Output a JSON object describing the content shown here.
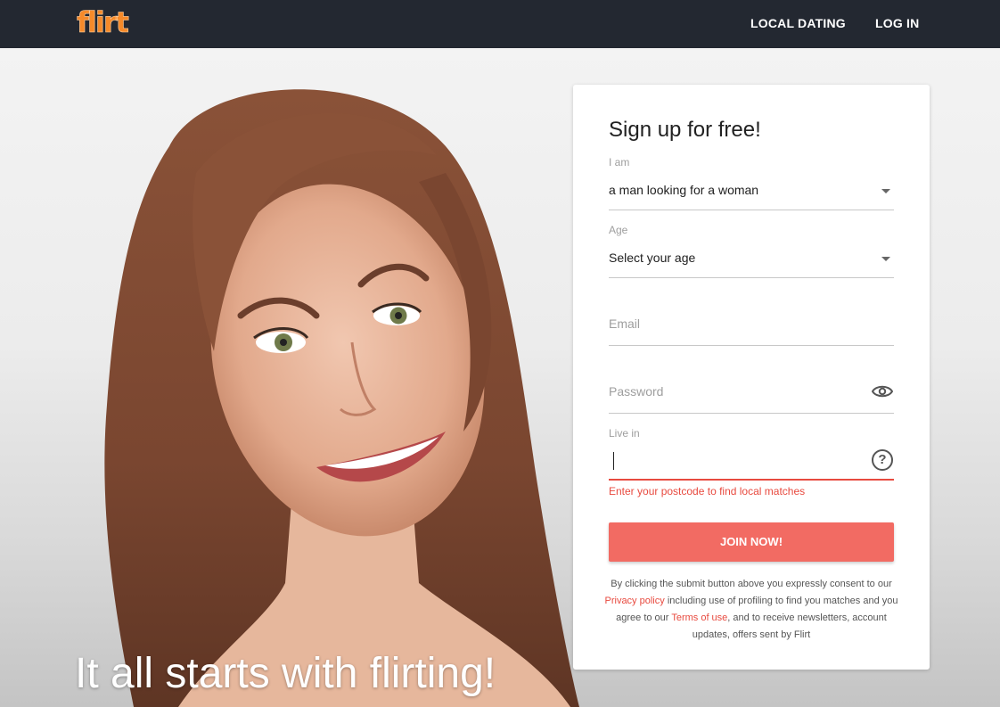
{
  "brand": {
    "logo_text": "flirt",
    "logo_color": "#f58a2a"
  },
  "nav": {
    "local_dating": "LOCAL DATING",
    "log_in": "LOG IN"
  },
  "hero": {
    "tagline": "It all starts with flirting!"
  },
  "form": {
    "title": "Sign up for free!",
    "gender": {
      "label": "I am",
      "value": "a man looking for a woman"
    },
    "age": {
      "label": "Age",
      "value": "Select your age"
    },
    "email": {
      "placeholder": "Email"
    },
    "password": {
      "placeholder": "Password"
    },
    "location": {
      "label": "Live in",
      "value": "",
      "error": "Enter your postcode to find local matches"
    },
    "join_label": "JOIN NOW!",
    "legal": {
      "part1": "By clicking the submit button above you expressly consent to our",
      "privacy_link": "Privacy policy",
      "part2": "including use of profiling to find you matches and you agree to our",
      "terms_link": "Terms of use",
      "part3": ", and to receive newsletters, account updates, offers sent by Flirt"
    }
  },
  "colors": {
    "topbar": "#232831",
    "accent": "#f26b63",
    "error": "#e84a3f"
  },
  "icons": [
    "dropdown-caret-icon",
    "eye-icon",
    "question-icon"
  ]
}
